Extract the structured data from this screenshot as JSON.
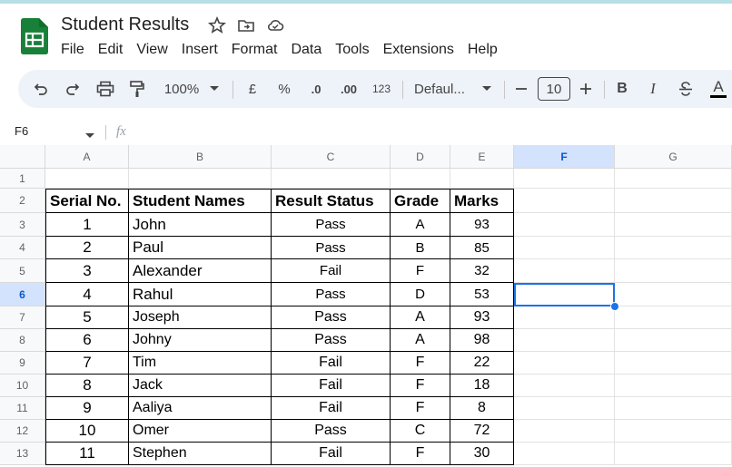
{
  "doc": {
    "title": "Student Results"
  },
  "menu": [
    "File",
    "Edit",
    "View",
    "Insert",
    "Format",
    "Data",
    "Tools",
    "Extensions",
    "Help"
  ],
  "toolbar": {
    "zoom": "100%",
    "currency": "£",
    "percent": "%",
    "dec_dec": ".0",
    "inc_dec": ".00",
    "numfmt": "123",
    "font": "Defaul...",
    "size": "10",
    "bold": "B",
    "italic": "I",
    "text_color": "A"
  },
  "formula_bar": {
    "cell_ref": "F6",
    "fx": "fx"
  },
  "columns": [
    "A",
    "B",
    "C",
    "D",
    "E",
    "F",
    "G"
  ],
  "rows": [
    "1",
    "2",
    "3",
    "4",
    "5",
    "6",
    "7",
    "8",
    "9",
    "10",
    "11",
    "12",
    "13"
  ],
  "table": {
    "headers": [
      "Serial No.",
      "Student Names",
      "Result Status",
      "Grade",
      "Marks"
    ],
    "rows": [
      [
        "1",
        "John",
        "Pass",
        "A",
        "93"
      ],
      [
        "2",
        "Paul",
        "Pass",
        "B",
        "85"
      ],
      [
        "3",
        "Alexander",
        "Fail",
        "F",
        "32"
      ],
      [
        "4",
        "Rahul",
        "Pass",
        "D",
        "53"
      ],
      [
        "5",
        "Joseph",
        "Pass",
        "A",
        "93"
      ],
      [
        "6",
        "Johny",
        "Pass",
        "A",
        "98"
      ],
      [
        "7",
        "Tim",
        "Fail",
        "F",
        "22"
      ],
      [
        "8",
        "Jack",
        "Fail",
        "F",
        "18"
      ],
      [
        "9",
        "Aaliya",
        "Fail",
        "F",
        "8"
      ],
      [
        "10",
        "Omer",
        "Pass",
        "C",
        "72"
      ],
      [
        "11",
        "Stephen",
        "Fail",
        "F",
        "30"
      ]
    ]
  },
  "selected_cell": "F6",
  "colors": {
    "accent": "#1a73e8",
    "sheets_green": "#188038",
    "toolbar_bg": "#eef2f9"
  }
}
